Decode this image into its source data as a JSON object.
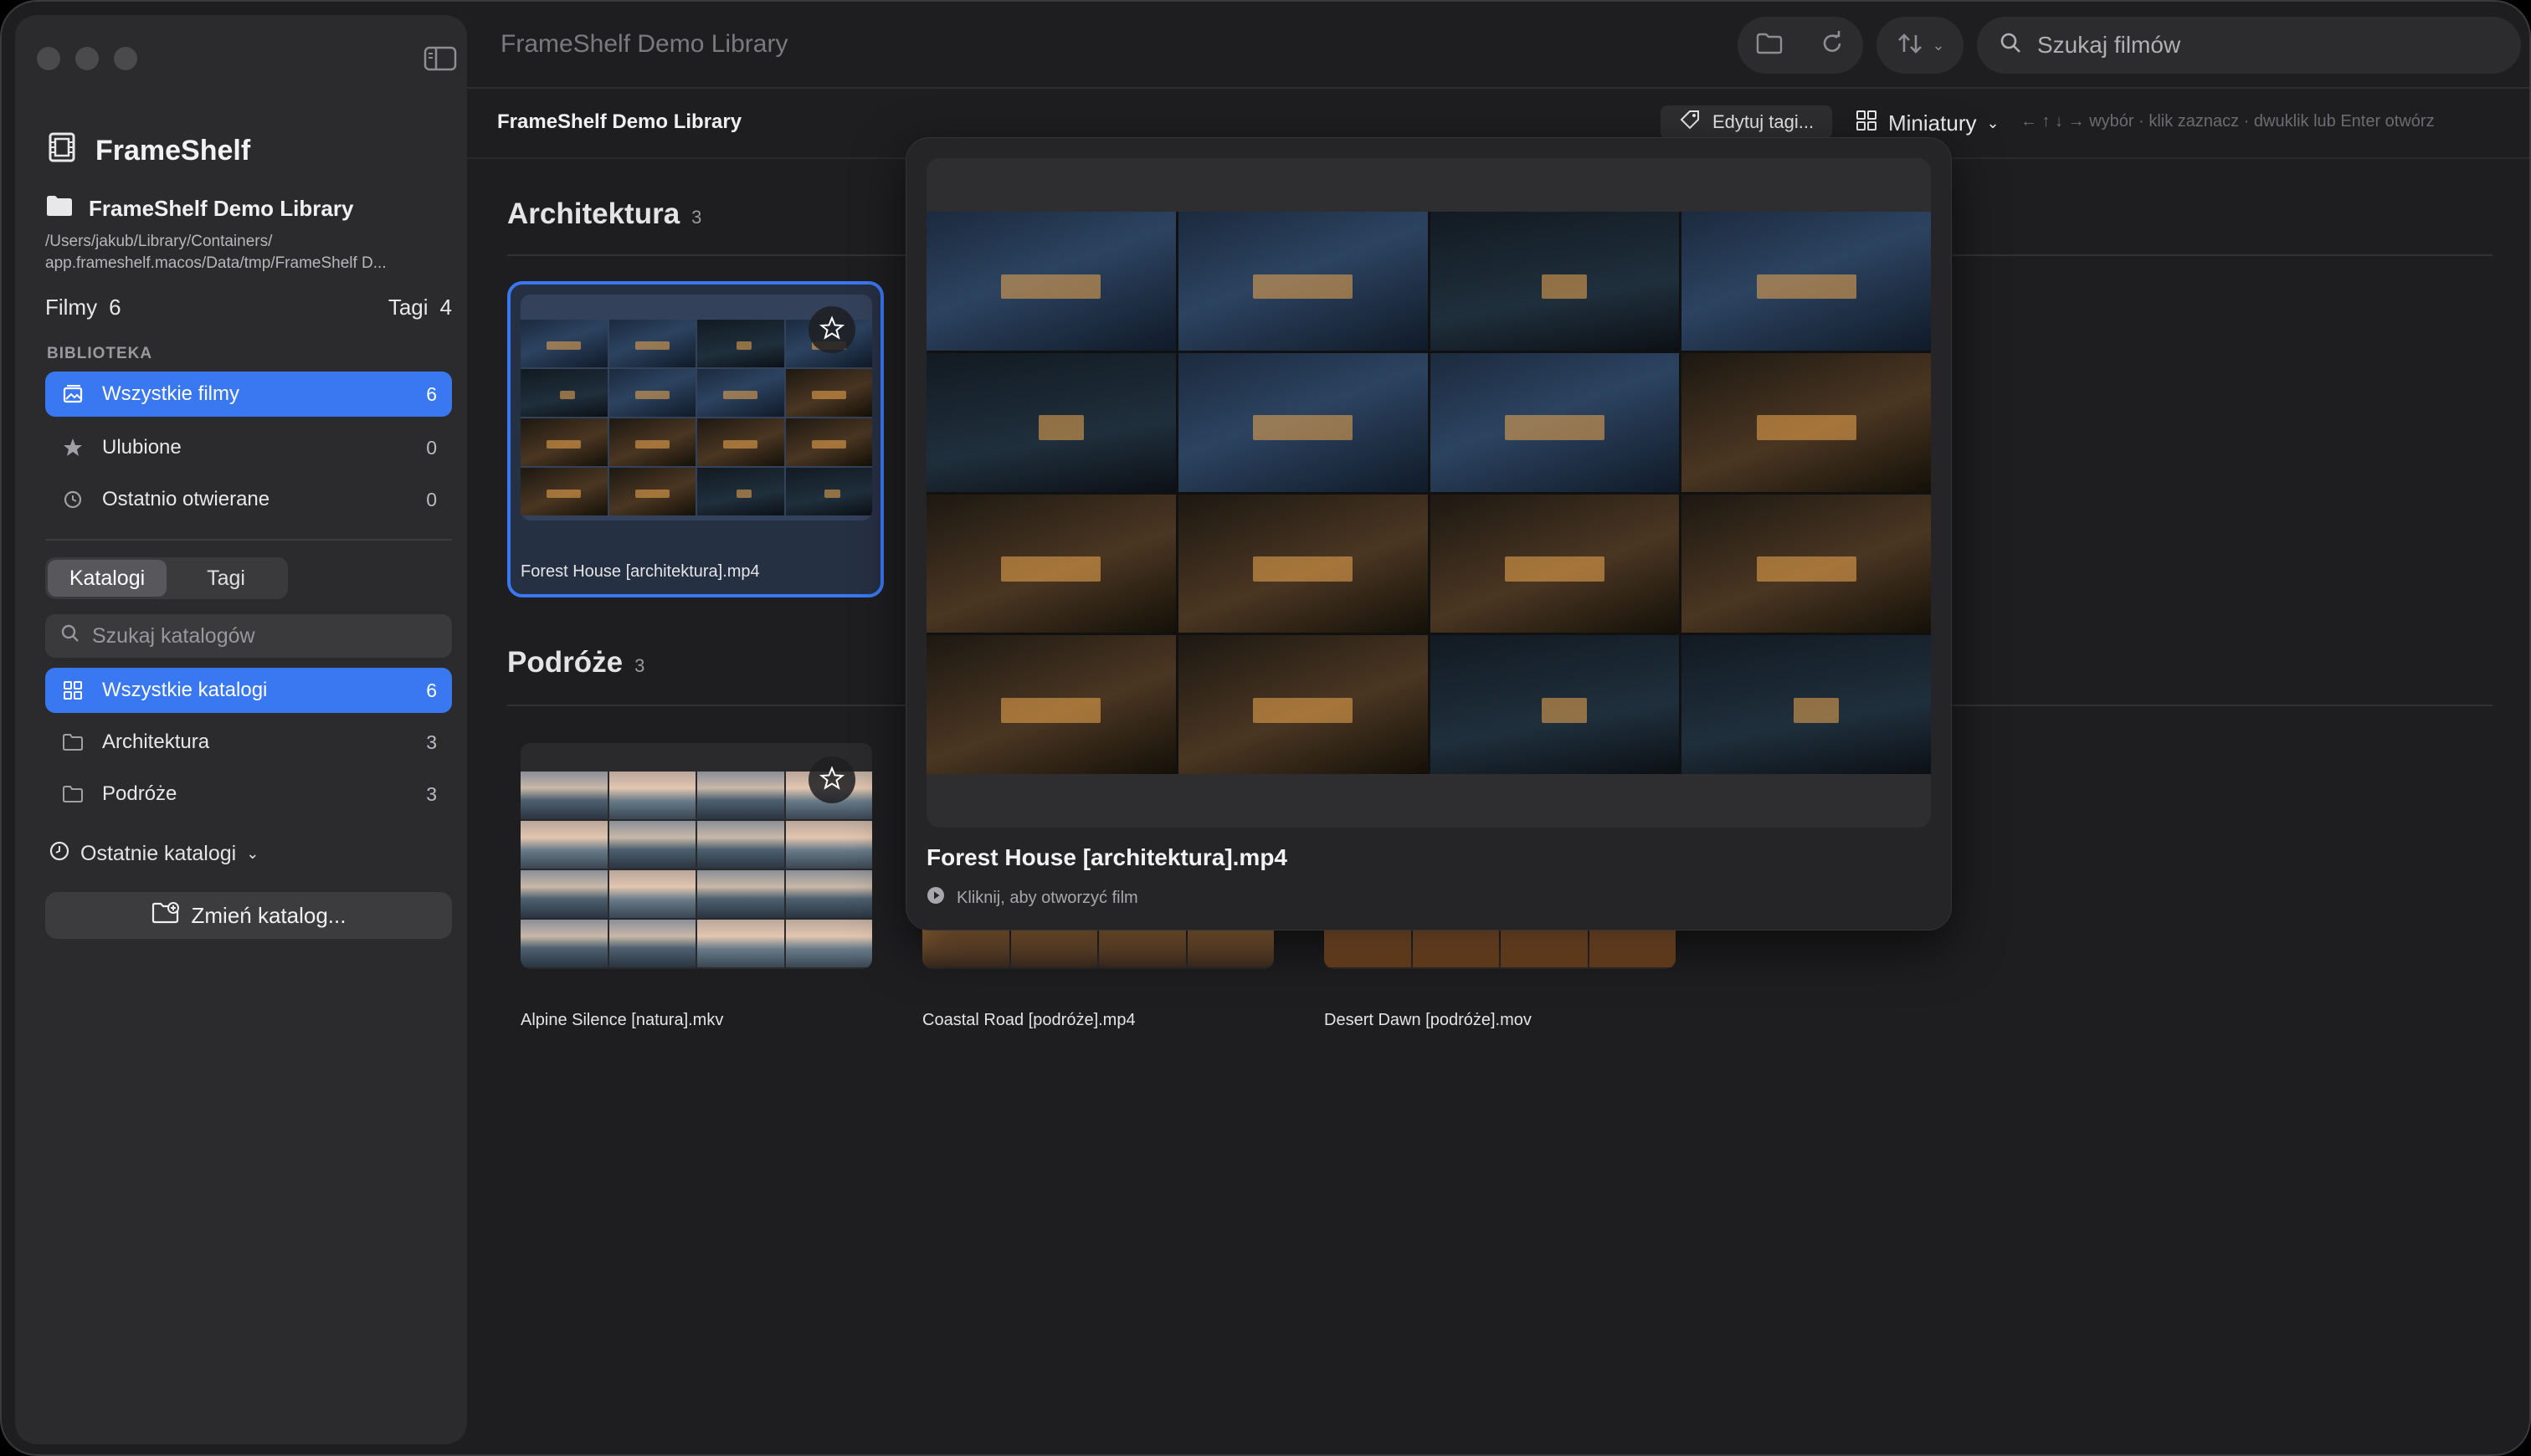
{
  "window": {
    "title": "FrameShelf Demo Library"
  },
  "sidebar": {
    "app_name": "FrameShelf",
    "library_name": "FrameShelf Demo Library",
    "library_path_line1": "/Users/jakub/Library/Containers/",
    "library_path_line2": "app.frameshelf.macos/Data/tmp/FrameShelf D...",
    "films_label": "Filmy",
    "films_count": "6",
    "tags_label": "Tagi",
    "tags_count": "4",
    "section_library": "BIBLIOTEKA",
    "library_items": [
      {
        "label": "Wszystkie filmy",
        "count": "6",
        "icon": "photo-library-icon"
      },
      {
        "label": "Ulubione",
        "count": "0",
        "icon": "star-icon"
      },
      {
        "label": "Ostatnio otwierane",
        "count": "0",
        "icon": "clock-history-icon"
      }
    ],
    "segments": [
      "Katalogi",
      "Tagi"
    ],
    "catalog_search_placeholder": "Szukaj katalogów",
    "catalog_items": [
      {
        "label": "Wszystkie katalogi",
        "count": "6",
        "icon": "grid-icon"
      },
      {
        "label": "Architektura",
        "count": "3",
        "icon": "folder-icon"
      },
      {
        "label": "Podróże",
        "count": "3",
        "icon": "folder-icon"
      }
    ],
    "recent_catalogs": "Ostatnie katalogi",
    "change_catalog": "Zmień katalog..."
  },
  "toolbar": {
    "search_placeholder": "Szukaj filmów"
  },
  "content": {
    "library_title": "FrameShelf Demo Library",
    "edit_tags": "Edytuj tagi...",
    "view_mode": "Miniatury",
    "hints": "← ↑ ↓ → wybór  ·  klik zaznacz  ·  dwuklik lub Enter otwórz",
    "groups": [
      {
        "title": "Architektura",
        "count": "3"
      },
      {
        "title": "Podróże",
        "count": "3"
      }
    ],
    "cards": [
      {
        "name": "Forest House [architektura].mp4"
      },
      {
        "name": "Alpine Silence [natura].mkv"
      },
      {
        "name": "Coastal Road [podróże].mp4"
      },
      {
        "name": "Desert Dawn [podróże].mov"
      }
    ]
  },
  "popover": {
    "title": "Forest House [architektura].mp4",
    "hint": "Kliknij, aby otworzyć film"
  },
  "colors": {
    "accent": "#3a78f2",
    "background": "#1e1e20",
    "sidebar": "#2b2b2d"
  }
}
